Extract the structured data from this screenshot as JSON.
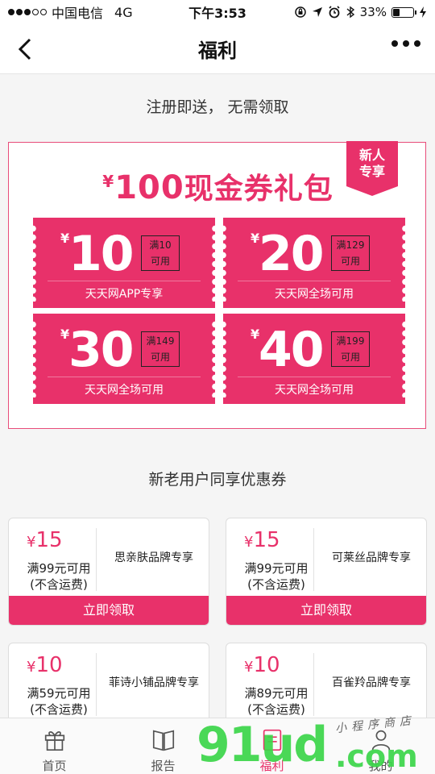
{
  "status_bar": {
    "carrier": "中国电信",
    "network": "4G",
    "time": "下午3:53",
    "battery": "33%",
    "battery_level": 0.33
  },
  "nav": {
    "title": "福利"
  },
  "new_user_section": {
    "title": "注册即送， 无需领取",
    "ribbon": [
      "新人",
      "专享"
    ],
    "pack_title": {
      "yen": "¥",
      "amount": "100",
      "text": "现金券礼包"
    },
    "tickets": [
      {
        "yen": "¥",
        "amount": "10",
        "cond": [
          "满10",
          "可用"
        ],
        "desc": "天天网APP专享"
      },
      {
        "yen": "¥",
        "amount": "20",
        "cond": [
          "满129",
          "可用"
        ],
        "desc": "天天网全场可用"
      },
      {
        "yen": "¥",
        "amount": "30",
        "cond": [
          "满149",
          "可用"
        ],
        "desc": "天天网全场可用"
      },
      {
        "yen": "¥",
        "amount": "40",
        "cond": [
          "满199",
          "可用"
        ],
        "desc": "天天网全场可用"
      }
    ]
  },
  "shared_section": {
    "title": "新老用户同享优惠券",
    "coupons": [
      {
        "yen": "¥",
        "amount": "15",
        "cond": [
          "满99元可用",
          "(不含运费)"
        ],
        "brand": "思亲肤品牌专享",
        "button": "立即领取"
      },
      {
        "yen": "¥",
        "amount": "15",
        "cond": [
          "满99元可用",
          "(不含运费)"
        ],
        "brand": "可莱丝品牌专享",
        "button": "立即领取"
      },
      {
        "yen": "¥",
        "amount": "10",
        "cond": [
          "满59元可用",
          "(不含运费)"
        ],
        "brand": "菲诗小铺品牌专享"
      },
      {
        "yen": "¥",
        "amount": "10",
        "cond": [
          "满89元可用",
          "(不含运费)"
        ],
        "brand": "百雀羚品牌专享"
      }
    ]
  },
  "tabbar": {
    "tabs": [
      {
        "label": "首页",
        "icon": "gift-icon"
      },
      {
        "label": "报告",
        "icon": "book-icon"
      },
      {
        "label": "福利",
        "icon": "welfare-icon",
        "active": true
      },
      {
        "label": "我的",
        "icon": "user-icon"
      }
    ]
  },
  "watermark": {
    "logo": "91ud",
    "suffix": ".com",
    "handwriting": "小程序商店"
  },
  "colors": {
    "accent": "#e8316a"
  }
}
